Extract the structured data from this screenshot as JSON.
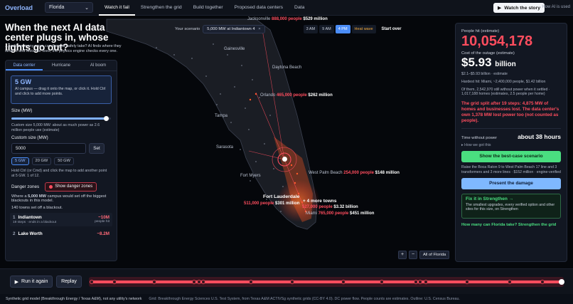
{
  "topbar": {
    "logo": "Overload",
    "state": "Florida",
    "tabs": [
      "Watch it fail",
      "Strengthen the grid",
      "Build together",
      "Proposed data centers",
      "Data"
    ],
    "watch_label": "Watch the story",
    "howai": "How AI is used"
  },
  "headline": {
    "title": "When the next AI data center plugs in, whose lights go out?",
    "sub": "...and how many more can the grid safely take? AI finds where they strain it and tests the fixes; the physics engine checks every one."
  },
  "left": {
    "tabs": [
      "Data center",
      "Hurricane",
      "AI boom"
    ],
    "card_big": "5 GW",
    "card_desc": "AI campus — drag it onto the map, or click it. Hold Ctrl and click to add more points.",
    "size_label": "Size (MW)",
    "size_note": "Custom size 5,000 MW: about as much power as 2.6 million people use (estimate)",
    "custom_label": "Custom size (MW)",
    "custom_value": "5000",
    "set_label": "Set",
    "chips": [
      "5 GW",
      "20 GW",
      "50 GW"
    ],
    "hold_note": "Hold Ctrl (or Cmd) and click the map to add another point at 5 GW. 1 of 12.",
    "danger_label": "Danger zones",
    "danger_btn": "Show danger zones",
    "where_note_a": "Where a ",
    "where_note_b": "5,000 MW",
    "where_note_c": " campus would set off the biggest blackouts in this model.",
    "towns_note": "140 towns set off a blackout.",
    "town1_rank": "1",
    "town1_name": "Indiantown",
    "town1_sub": "19 steps · ends in a blackout",
    "town1_val": "~10M",
    "town1_unit": "people hit",
    "town2_rank": "2",
    "town2_name": "Lake Worth",
    "town2_val": "~8.2M"
  },
  "scenario": {
    "label": "Your scenario",
    "chip": "5,000 MW at Indiantown 4",
    "chip_close": "×",
    "times": [
      "3 AM",
      "9 AM",
      "4 PM",
      "Heat wave"
    ],
    "start_over": "Start over"
  },
  "map_labels": {
    "jacksonville": "Jacksonville",
    "jax_people": "888,000 people",
    "jax_cost": "$529 million",
    "gainesville": "Gainesville",
    "daytona": "Daytona Beach",
    "orlando": "Orlando",
    "orl_people": "465,000 people",
    "orl_cost": "$262 million",
    "tampa": "Tampa",
    "sarasota": "Sarasota",
    "fort_myers": "Fort Myers",
    "wpb": "West Palm Beach",
    "wpb_people": "254,000 people",
    "wpb_cost": "$148 million",
    "ftl": "Fort Lauderdale",
    "ftl_people": "511,000 people",
    "ftl_cost": "$301 million",
    "more_towns": "+ 4 more towns",
    "mt_people": "527,000 people",
    "mt_cost": "$3.32 billion",
    "miami": "Miami",
    "miami_people": "765,000 people",
    "miami_cost": "$451 million"
  },
  "zoom": {
    "plus": "+",
    "minus": "−",
    "all": "All of Florida"
  },
  "right": {
    "people_label": "People hit (estimate)",
    "people_val": "10,054,178",
    "cost_label": "Cost of the outage (estimate)",
    "cost_val": "$5.93",
    "cost_unit": "billion",
    "cost_range": "$2.1–$5.93 billion · estimate",
    "hardest": "Hardest hit: Miami, ~2,400,000 people, $1.42 billion",
    "of_them": "Of them, 2,542,970 still without power when it settled · 1,017,188 homes (estimates, 2.5 people per home)",
    "warn": "The grid split after 19 steps: 4,875 MW of homes and businesses lost. The data center's own 1,378 MW lost power too (not counted as people).",
    "time_label": "Time without power",
    "time_val": "about 38 hours",
    "how_got": "▸ How we got this",
    "best_btn": "Show the best-case scenario",
    "raise_note": "Raise the Boca Raton 9 to West Palm Beach 17 line and 3 transformers and 3 more lines · $152 million · engine-verified",
    "damage_btn": "Present the damage",
    "fix_title": "Fix it in Strengthen →",
    "fix_desc": "The smallest upgrades, every verified option and other sites for this size, on Strengthen",
    "question": "How many can Florida take? Strengthen the grid"
  },
  "playbar": {
    "run_label": "Run it again",
    "replay_label": "Replay"
  },
  "footer": {
    "model": "Synthetic grid model (Breakthrough Energy / Texas A&M), not any utility's network",
    "source": "Grid: Breakthrough Energy Sciences U.S. Test System, from Texas A&M ACTIVSg synthetic grids (CC-BY 4.0). DC power flow. People counts are estimates. Outline: U.S. Census Bureau."
  }
}
